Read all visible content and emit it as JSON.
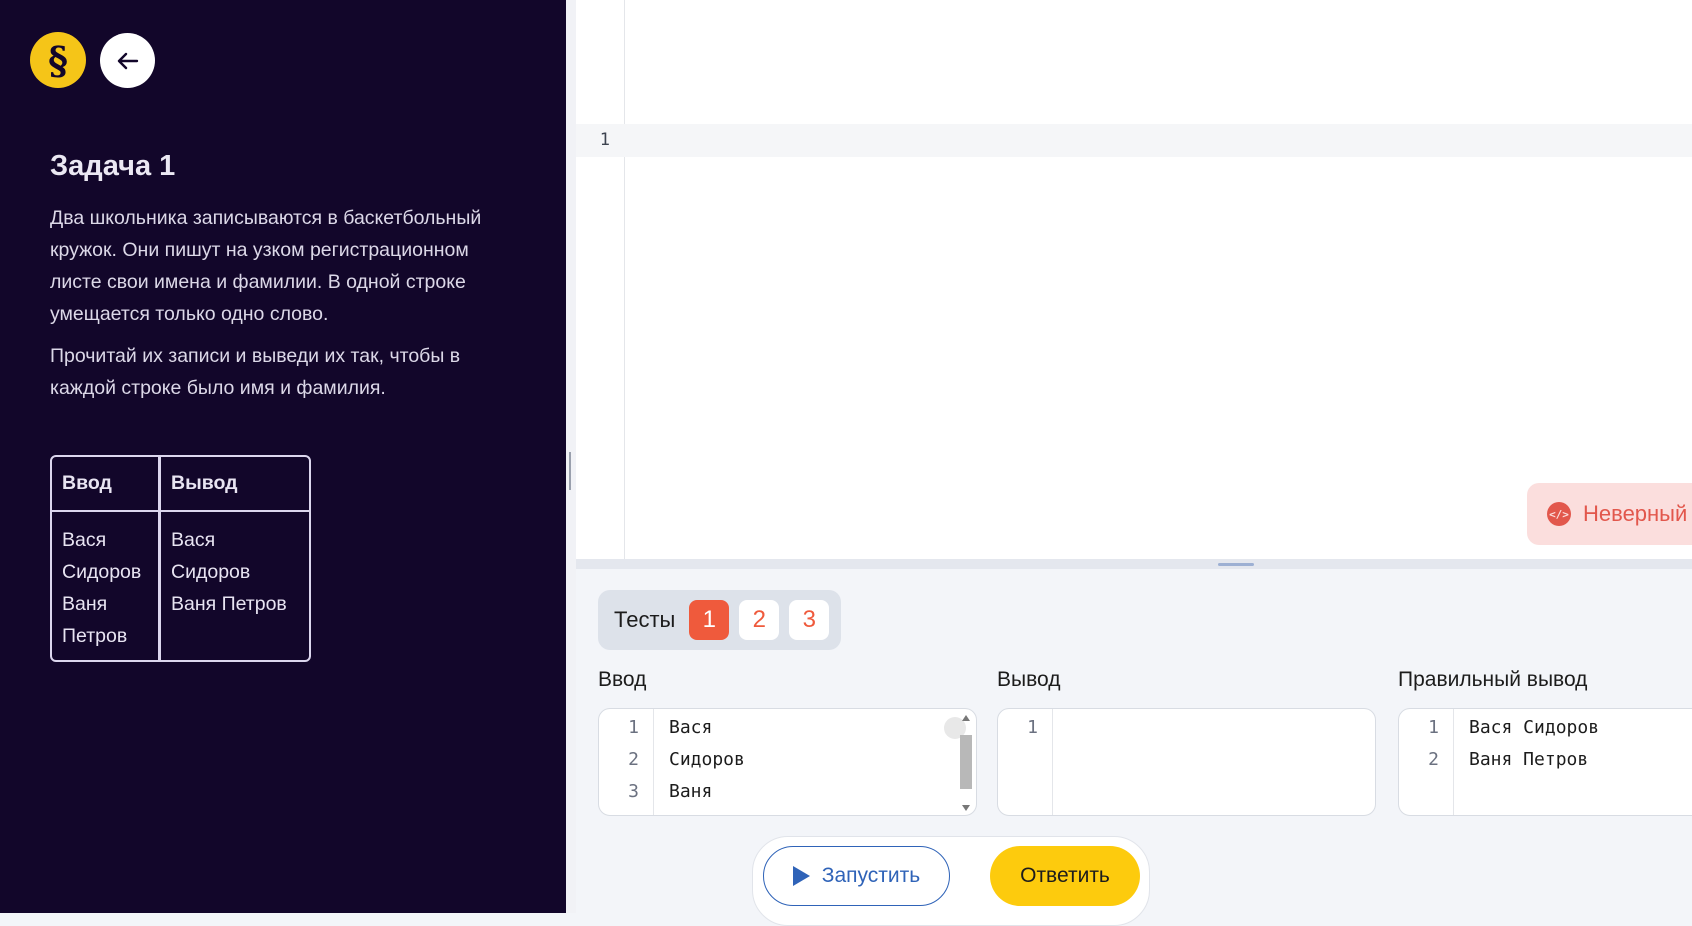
{
  "sidebar": {
    "logo_glyph": "§",
    "back_icon": "arrow-left-icon",
    "task_title": "Задача 1",
    "description": [
      "Два школьника записываются в баскетбольный кружок. Они пишут на узком регистрационном листе свои имена и фамилии. В одной строке умещается только одно слово.",
      "Прочитай их записи и выведи их так, чтобы в каждой строке было имя и фамилия."
    ],
    "example": {
      "headers": [
        "Ввод",
        "Вывод"
      ],
      "input": "Вася\nСидоров\nВаня\nПетров",
      "output": "Вася Сидоров\nВаня Петров"
    }
  },
  "editor": {
    "line_numbers": [
      "1"
    ],
    "badge_label": "Неверный",
    "badge_icon": "code-icon"
  },
  "tests": {
    "label": "Тесты",
    "tabs": [
      "1",
      "2",
      "3"
    ],
    "active": "1"
  },
  "panes": {
    "input": {
      "label": "Ввод",
      "lines": [
        {
          "n": "1",
          "t": "Вася"
        },
        {
          "n": "2",
          "t": "Сидоров"
        },
        {
          "n": "3",
          "t": "Ваня"
        }
      ]
    },
    "output": {
      "label": "Вывод",
      "lines": [
        {
          "n": "1",
          "t": ""
        }
      ]
    },
    "expected": {
      "label": "Правильный вывод",
      "lines": [
        {
          "n": "1",
          "t": "Вася Сидоров"
        },
        {
          "n": "2",
          "t": "Ваня Петров"
        }
      ]
    }
  },
  "actions": {
    "run_label": "Запустить",
    "answer_label": "Ответить"
  },
  "colors": {
    "sidebar_bg": "#12062a",
    "accent_yellow": "#fdcb0d",
    "error_red": "#ef5a3c",
    "link_blue": "#2f63b8"
  }
}
